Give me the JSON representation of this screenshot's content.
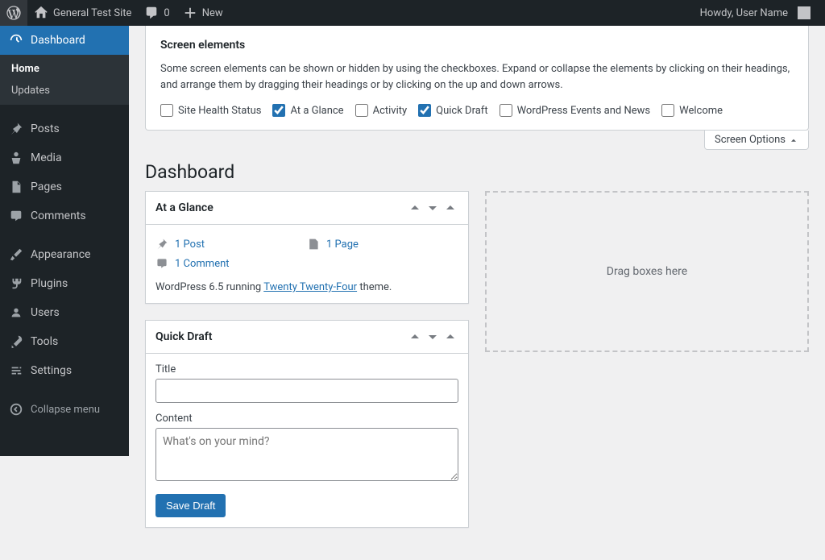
{
  "adminbar": {
    "site_name": "General Test Site",
    "comments_count": "0",
    "new_label": "New",
    "howdy": "Howdy, User Name"
  },
  "adminmenu": {
    "dashboard": "Dashboard",
    "sub_home": "Home",
    "sub_updates": "Updates",
    "posts": "Posts",
    "media": "Media",
    "pages": "Pages",
    "comments": "Comments",
    "appearance": "Appearance",
    "plugins": "Plugins",
    "users": "Users",
    "tools": "Tools",
    "settings": "Settings",
    "collapse": "Collapse menu"
  },
  "screen_options": {
    "heading": "Screen elements",
    "description": "Some screen elements can be shown or hidden by using the checkboxes. Expand or collapse the elements by clicking on their headings, and arrange them by dragging their headings or by clicking on the up and down arrows.",
    "checkboxes": [
      {
        "label": "Site Health Status",
        "checked": false
      },
      {
        "label": "At a Glance",
        "checked": true
      },
      {
        "label": "Activity",
        "checked": false
      },
      {
        "label": "Quick Draft",
        "checked": true
      },
      {
        "label": "WordPress Events and News",
        "checked": false
      },
      {
        "label": "Welcome",
        "checked": false
      }
    ],
    "tab_label": "Screen Options"
  },
  "page_title": "Dashboard",
  "at_a_glance": {
    "title": "At a Glance",
    "posts": "1 Post",
    "pages": "1 Page",
    "comments": "1 Comment",
    "version_prefix": "WordPress 6.5 running ",
    "theme_name": "Twenty Twenty-Four",
    "version_suffix": " theme."
  },
  "quick_draft": {
    "title": "Quick Draft",
    "title_label": "Title",
    "content_label": "Content",
    "content_placeholder": "What's on your mind?",
    "save_label": "Save Draft"
  },
  "empty_drop": "Drag boxes here"
}
